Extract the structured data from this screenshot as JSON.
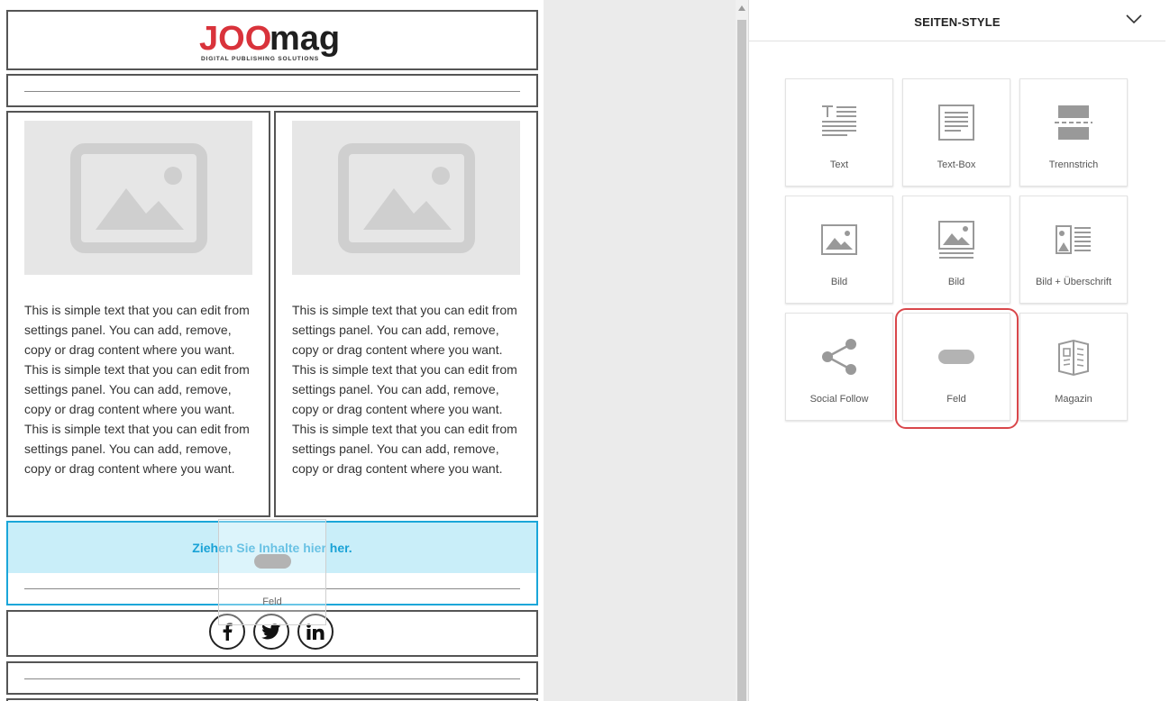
{
  "canvas": {
    "logo": {
      "wordmark_red": "JOO",
      "wordmark_dark": "mag",
      "tagline": "DIGITAL PUBLISHING SOLUTIONS"
    },
    "columns": [
      {
        "text": "This is simple text that you can edit from settings panel. You can add, remove, copy or drag content where you want. This is simple text that you can edit from settings panel. You can add, remove, copy or drag content where you want. This is simple text that you can edit from settings panel. You can add, remove, copy or drag content where you want."
      },
      {
        "text": "This is simple text that you can edit from settings panel. You can add, remove, copy or drag content where you want. This is simple text that you can edit from settings panel. You can add, remove, copy or drag content where you want. This is simple text that you can edit from settings panel. You can add, remove, copy or drag content where you want."
      }
    ],
    "drop_zone_text": "Ziehen Sie Inhalte hier her.",
    "drag_ghost_label": "Feld",
    "social": [
      "f",
      "t",
      "in"
    ]
  },
  "panel": {
    "title": "SEITEN-STYLE",
    "tiles": [
      {
        "label": "Text",
        "icon": "text-icon"
      },
      {
        "label": "Text-Box",
        "icon": "text-box-icon"
      },
      {
        "label": "Trennstrich",
        "icon": "divider-icon"
      },
      {
        "label": "Bild",
        "icon": "image-icon"
      },
      {
        "label": "Bild",
        "icon": "image-caption-icon"
      },
      {
        "label": "Bild + Überschrift",
        "icon": "image-heading-icon"
      },
      {
        "label": "Social Follow",
        "icon": "share-icon"
      },
      {
        "label": "Feld",
        "icon": "button-icon"
      },
      {
        "label": "Magazin",
        "icon": "magazine-icon"
      }
    ],
    "accent": "#d9474b"
  },
  "colors": {
    "drop_zone_bg": "#c9eef9",
    "drop_zone_border": "#1aa6d9"
  }
}
